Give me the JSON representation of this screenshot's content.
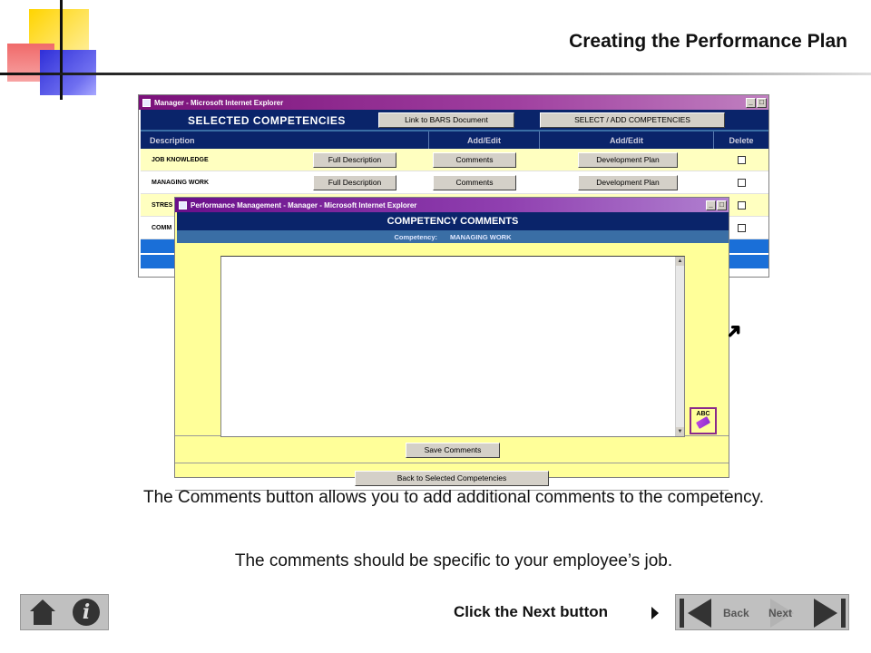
{
  "slide": {
    "title": "Creating the Performance Plan"
  },
  "back_window": {
    "title": "Manager - Microsoft Internet Explorer",
    "header_title": "SELECTED COMPETENCIES",
    "bars_button": "Link to BARS Document",
    "select_add_button": "SELECT / ADD COMPETENCIES",
    "columns": [
      "Description",
      "Add/Edit",
      "Add/Edit",
      "Delete"
    ],
    "rows": [
      {
        "label": "JOB KNOWLEDGE",
        "full": "Full Description",
        "comments": "Comments",
        "dev": "Development Plan"
      },
      {
        "label": "MANAGING WORK",
        "full": "Full Description",
        "comments": "Comments",
        "dev": "Development Plan"
      },
      {
        "label": "STRES"
      },
      {
        "label": "COMM"
      }
    ]
  },
  "front_window": {
    "title": "Performance Management - Manager - Microsoft Internet Explorer",
    "header": "COMPETENCY COMMENTS",
    "competency_label": "Competency:",
    "competency_value": "MANAGING WORK",
    "spell_label": "ABC",
    "save_button": "Save Comments",
    "back_button": "Back to Selected Competencies",
    "comment_value": ""
  },
  "window_controls": {
    "minimize": "_",
    "maximize": "□",
    "close": "×"
  },
  "description": {
    "line1": "The Comments button allows you to add additional comments to the competency.",
    "line2": "The comments should be specific to your employee’s job."
  },
  "navigation": {
    "click_next": "Click the Next button",
    "back": "Back",
    "next": "Next"
  },
  "icons": {
    "home": "home-icon",
    "info": "info-icon",
    "cursor": "arrow-cursor-icon",
    "spell": "spell-check-icon"
  },
  "colors": {
    "header_navy": "#0a246a",
    "row_yellow": "#ffffc0",
    "panel_yellow": "#ffff99",
    "titlebar_purple": "#7a107a",
    "row_blue": "#1a6fd8"
  }
}
